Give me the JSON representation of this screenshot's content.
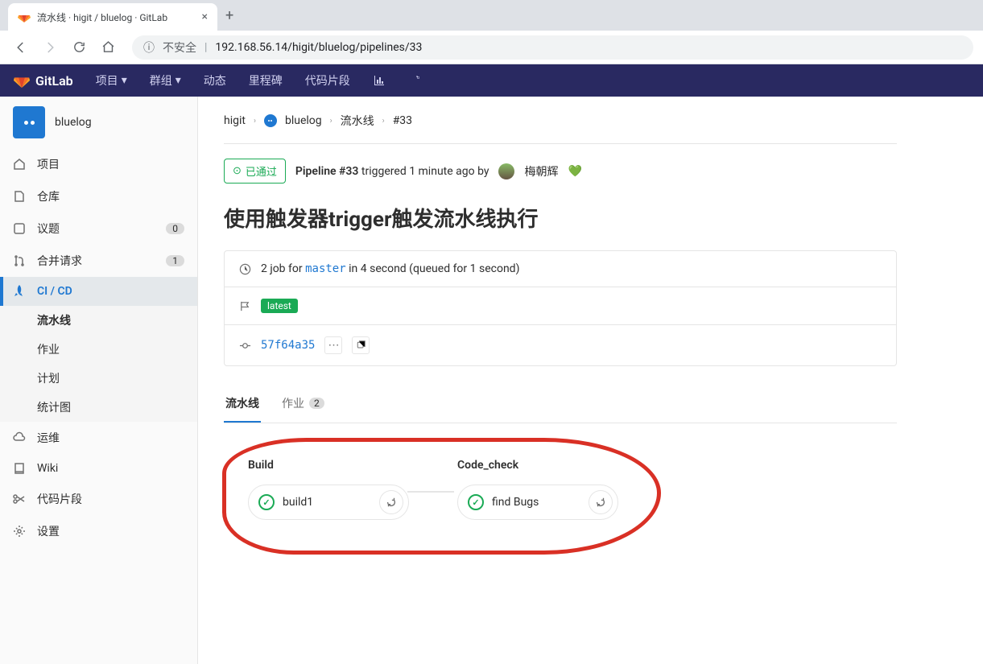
{
  "browser": {
    "tab_title": "流水线 · higit / bluelog · GitLab",
    "insecure_label": "不安全",
    "url": "192.168.56.14/higit/bluelog/pipelines/33"
  },
  "topnav": {
    "brand": "GitLab",
    "items": [
      "项目",
      "群组",
      "动态",
      "里程碑",
      "代码片段"
    ]
  },
  "sidebar": {
    "project_name": "bluelog",
    "items": [
      {
        "label": "项目"
      },
      {
        "label": "仓库"
      },
      {
        "label": "议题",
        "badge": "0"
      },
      {
        "label": "合并请求",
        "badge": "1"
      },
      {
        "label": "CI / CD",
        "active": true,
        "sub": [
          "流水线",
          "作业",
          "计划",
          "统计图"
        ],
        "sub_active": 0
      },
      {
        "label": "运维"
      },
      {
        "label": "Wiki"
      },
      {
        "label": "代码片段"
      },
      {
        "label": "设置"
      }
    ]
  },
  "breadcrumb": {
    "items": [
      "higit",
      "bluelog",
      "流水线",
      "#33"
    ]
  },
  "status": {
    "badge": "已通过",
    "pipeline_label": "Pipeline #33",
    "triggered_text": "triggered 1 minute ago by",
    "user": "梅朝辉"
  },
  "page_title": "使用触发器trigger触发流水线执行",
  "info": {
    "jobs_text_prefix": "2 job for",
    "branch": "master",
    "jobs_text_suffix": "in 4 second (queued for 1 second)",
    "tag": "latest",
    "commit": "57f64a35"
  },
  "tabs": {
    "pipeline": "流水线",
    "jobs": "作业",
    "jobs_count": "2"
  },
  "pipeline": {
    "stages": [
      {
        "name": "Build",
        "jobs": [
          {
            "name": "build1"
          }
        ]
      },
      {
        "name": "Code_check",
        "jobs": [
          {
            "name": "find Bugs"
          }
        ]
      }
    ]
  }
}
